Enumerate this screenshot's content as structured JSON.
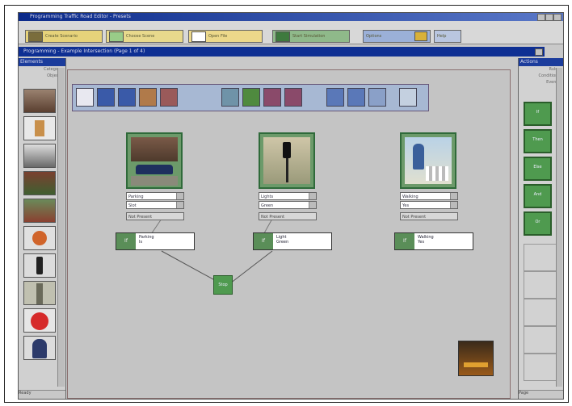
{
  "window": {
    "title": "Programming Traffic Road Editor - Presets"
  },
  "toolbar": {
    "buttons": [
      {
        "label": "Create Scenario"
      },
      {
        "label": "Choose Scene"
      },
      {
        "label": "Open File"
      },
      {
        "label": "Start Simulation"
      },
      {
        "label": "Options"
      },
      {
        "label": "Help"
      }
    ]
  },
  "editor": {
    "title": "Programming - Example Intersection (Page 1 of 4)"
  },
  "left_panel": {
    "header": "Elements",
    "labels": [
      "Category",
      "Objects"
    ],
    "status": "Ready"
  },
  "right_panel": {
    "header": "Actions",
    "labels": [
      "Rules",
      "Conditions",
      "Events"
    ],
    "tiles": [
      "If",
      "Then",
      "Else",
      "And",
      "Or"
    ],
    "status": "Page"
  },
  "nodes": [
    {
      "fields": [
        "Parking",
        "Slot"
      ],
      "select": "Not Present",
      "condition": [
        "Parking",
        "Is"
      ]
    },
    {
      "fields": [
        "Lights",
        "Green"
      ],
      "select": "Not Present",
      "condition": [
        "Light",
        "Green"
      ]
    },
    {
      "fields": [
        "Walking",
        "Yes"
      ],
      "select": "Not Present",
      "condition": [
        "Walking",
        "Yes"
      ]
    }
  ],
  "join_node": {
    "label": "Stop"
  },
  "colors": {
    "title_bar": "#0b2a8a",
    "canvas": "#c4c4c4",
    "node_green": "#4f9a4f"
  }
}
